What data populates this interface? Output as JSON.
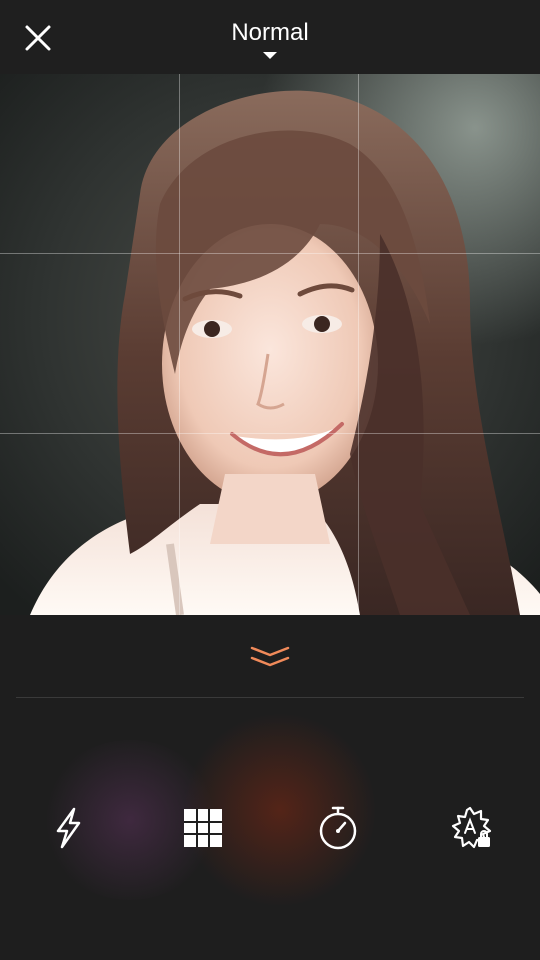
{
  "header": {
    "mode_label": "Normal"
  },
  "icons": {
    "close": "close-icon",
    "mode_caret": "caret-down-icon",
    "expand": "double-chevron-down-icon",
    "flash": "flash-icon",
    "grid": "grid-icon",
    "timer": "timer-icon",
    "auto_lock": "auto-exposure-lock-icon"
  },
  "colors": {
    "background": "#1e1e1e",
    "accent": "#f08a5a",
    "icon": "#ffffff"
  }
}
